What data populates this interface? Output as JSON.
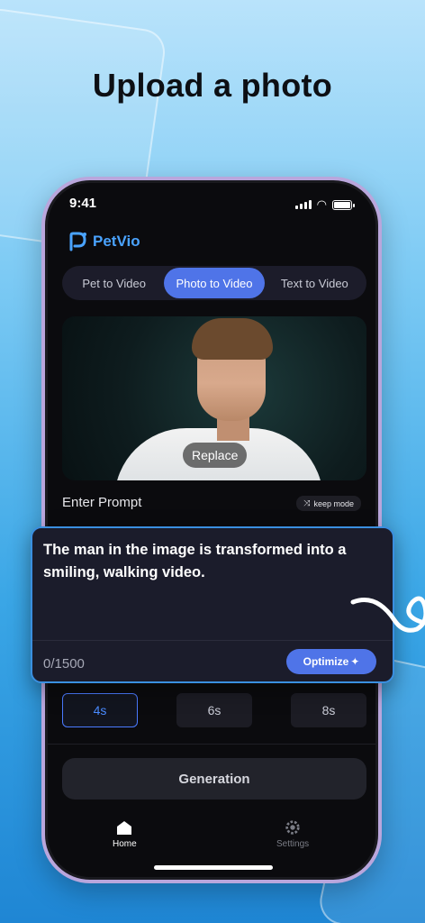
{
  "headline": "Upload a photo",
  "status": {
    "time": "9:41"
  },
  "app": {
    "name": "PetVio"
  },
  "tabs": [
    {
      "label": "Pet to Video",
      "active": false
    },
    {
      "label": "Photo to Video",
      "active": true
    },
    {
      "label": "Text to Video",
      "active": false
    }
  ],
  "photo": {
    "replace_label": "Replace"
  },
  "prompt": {
    "label": "Enter Prompt",
    "keep_mode_label": "keep mode",
    "text": "The man in the image is transformed into a smiling, walking video.",
    "counter": "0/1500",
    "optimize_label": "Optimize"
  },
  "durations": [
    {
      "label": "4s",
      "active": true
    },
    {
      "label": "6s",
      "active": false
    },
    {
      "label": "8s",
      "active": false
    }
  ],
  "generation_label": "Generation",
  "bottom_nav": {
    "home": "Home",
    "settings": "Settings"
  },
  "colors": {
    "accent": "#4f74e8",
    "logo": "#4aa3ff",
    "card_border": "#3a8fe0"
  }
}
